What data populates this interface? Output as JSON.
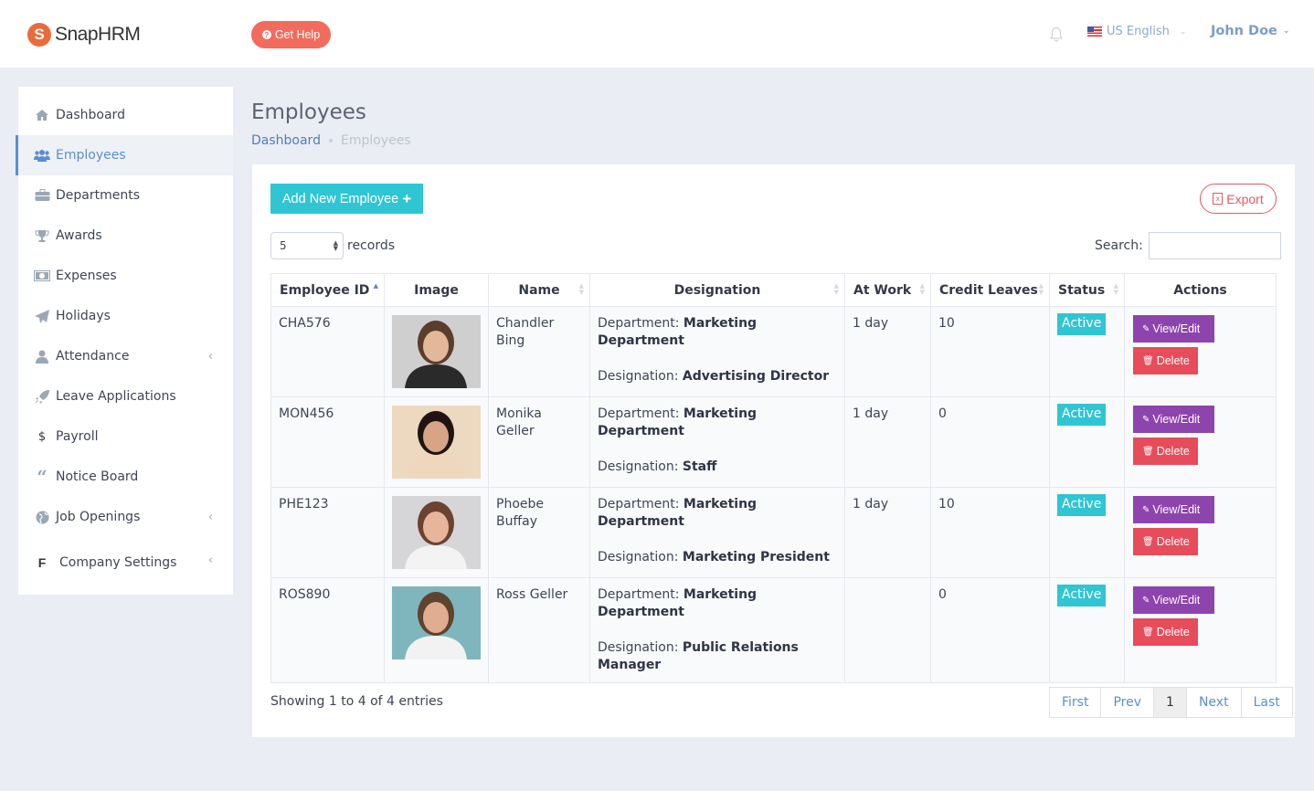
{
  "header": {
    "brand": "SnapHRM",
    "help_label": "Get Help",
    "language": "US English",
    "user_name": "John Doe"
  },
  "sidebar": {
    "items": [
      {
        "label": "Dashboard",
        "icon": "home-icon"
      },
      {
        "label": "Employees",
        "icon": "users-icon",
        "active": true
      },
      {
        "label": "Departments",
        "icon": "briefcase-icon"
      },
      {
        "label": "Awards",
        "icon": "trophy-icon"
      },
      {
        "label": "Expenses",
        "icon": "money-icon"
      },
      {
        "label": "Holidays",
        "icon": "paper-plane-icon"
      },
      {
        "label": "Attendance",
        "icon": "user-icon",
        "expandable": true
      },
      {
        "label": "Leave Applications",
        "icon": "rocket-icon"
      },
      {
        "label": "Payroll",
        "icon": "dollar-icon",
        "glyph": "$"
      },
      {
        "label": "Notice Board",
        "icon": "quote-icon"
      },
      {
        "label": "Job Openings",
        "icon": "globe-icon",
        "expandable": true
      },
      {
        "label": "Company Settings",
        "icon": "f-letter-icon",
        "glyph": "F",
        "expandable": true
      }
    ]
  },
  "page": {
    "title": "Employees",
    "breadcrumb": {
      "parent": "Dashboard",
      "current": "Employees"
    }
  },
  "toolbar": {
    "add_label": "Add New Employee",
    "export_label": "Export",
    "length_value": "5",
    "length_suffix": "records",
    "search_label": "Search:",
    "search_value": ""
  },
  "table": {
    "columns": [
      "Employee ID",
      "Image",
      "Name",
      "Designation",
      "At Work",
      "Credit Leaves",
      "Status",
      "Actions"
    ],
    "dept_prefix": "Department:",
    "desig_prefix": "Designation:",
    "view_label": "View/Edit",
    "delete_label": "Delete",
    "rows": [
      {
        "id": "CHA576",
        "name": "Chandler Bing",
        "department": "Marketing Department",
        "designation": "Advertising Director",
        "at_work": "1 day",
        "credit_leaves": "10",
        "status": "Active",
        "photo": "man-suit-portrait"
      },
      {
        "id": "MON456",
        "name": "Monika Geller",
        "department": "Marketing Department",
        "designation": "Staff",
        "at_work": "1 day",
        "credit_leaves": "0",
        "status": "Active",
        "photo": "woman-dark-hair-portrait"
      },
      {
        "id": "PHE123",
        "name": "Phoebe Buffay",
        "department": "Marketing Department",
        "designation": "Marketing President",
        "at_work": "1 day",
        "credit_leaves": "10",
        "status": "Active",
        "photo": "woman-long-hair-portrait"
      },
      {
        "id": "ROS890",
        "name": "Ross Geller",
        "department": "Marketing Department",
        "designation": "Public Relations Manager",
        "at_work": "",
        "credit_leaves": "0",
        "status": "Active",
        "photo": "man-office-portrait"
      }
    ]
  },
  "footer": {
    "info": "Showing 1 to 4 of 4 entries",
    "pagination": [
      "First",
      "Prev",
      "1",
      "Next",
      "Last"
    ],
    "current_page": "1"
  },
  "colors": {
    "accent": "#30c5d3",
    "primary_link": "#5a8ed0",
    "view_button": "#8e44ad",
    "delete_button": "#e74c5b",
    "help_button": "#f26b5c",
    "export": "#e05a63"
  }
}
